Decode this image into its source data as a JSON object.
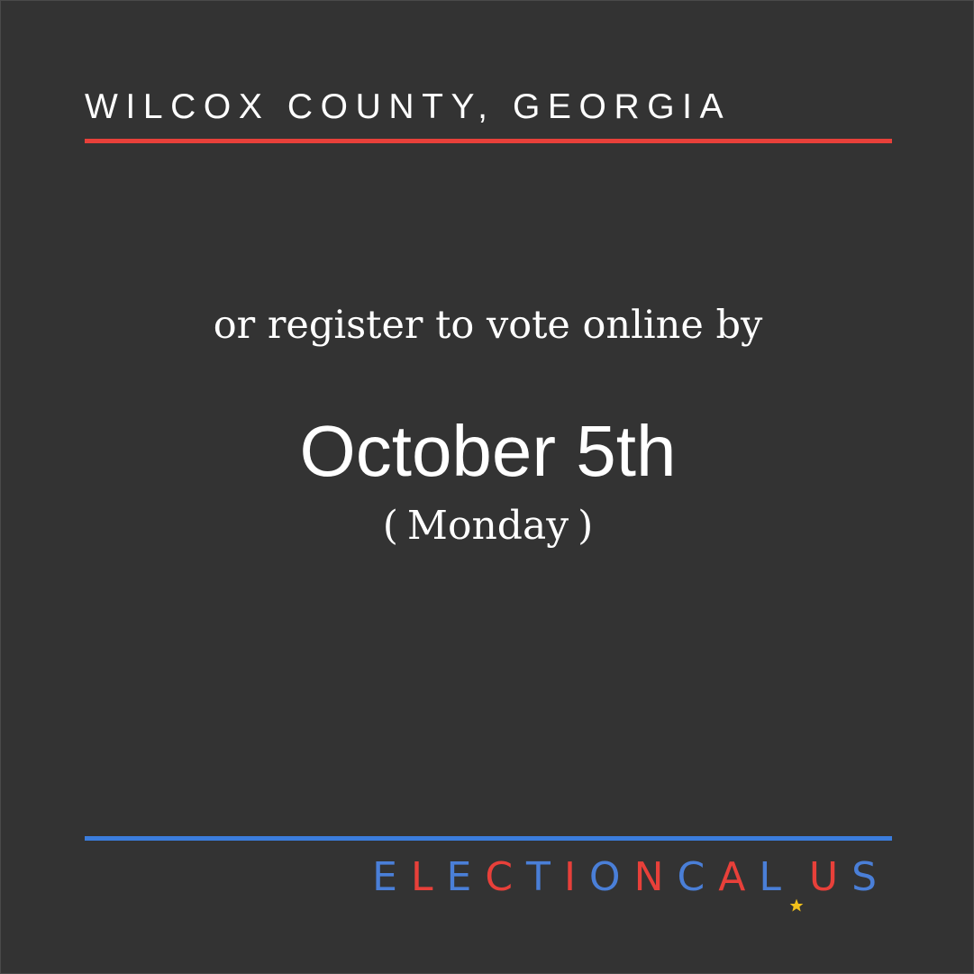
{
  "header": {
    "county": "WILCOX COUNTY, GEORGIA"
  },
  "message": {
    "lead": "or register to vote online by",
    "date": "October 5th",
    "weekday_open": "(",
    "weekday": "Monday",
    "weekday_close": ")"
  },
  "brand": {
    "name": "ELECTIONCAL",
    "tld": "US",
    "star_icon": "star-icon"
  },
  "colors": {
    "background": "#333333",
    "accent_red": "#e8403a",
    "accent_blue": "#3b7ddd",
    "star_yellow": "#f2c11b",
    "text": "#ffffff"
  }
}
